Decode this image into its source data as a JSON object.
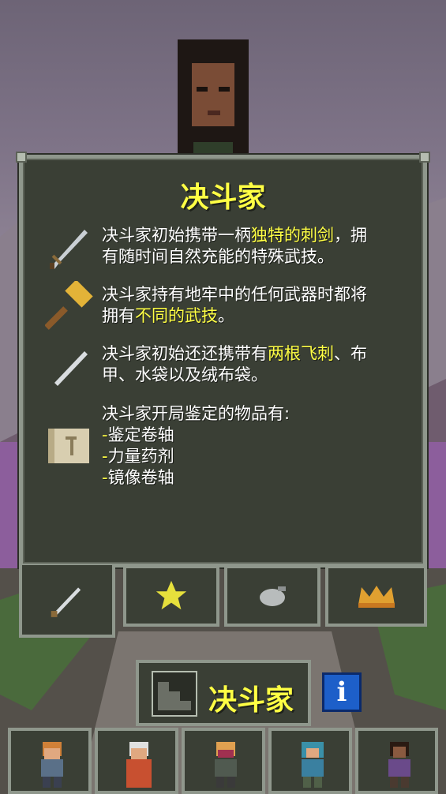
{
  "panel": {
    "title": "决斗家",
    "entries": [
      {
        "icon": "rapier-icon",
        "lines": [
          {
            "a": "决斗家初始携带一柄",
            "hl": "独特的刺剑",
            "b": "，拥"
          },
          {
            "a": "有随时间自然充能的特殊武技。",
            "hl": "",
            "b": ""
          }
        ]
      },
      {
        "icon": "hammer-icon",
        "lines": [
          {
            "a": "决斗家持有地牢中的任何武器时都将",
            "hl": "",
            "b": ""
          },
          {
            "a": "拥有",
            "hl": "不同的武技",
            "b": "。"
          }
        ]
      },
      {
        "icon": "throwing-spike-icon",
        "lines": [
          {
            "a": "决斗家初始还还携带有",
            "hl": "两根飞刺",
            "b": "、布"
          },
          {
            "a": "甲、水袋以及绒布袋。",
            "hl": "",
            "b": ""
          }
        ]
      },
      {
        "icon": "scroll-icon",
        "lines": [
          {
            "a": "决斗家开局鉴定的物品有:",
            "hl": "",
            "b": ""
          },
          {
            "a": "",
            "hl": "-",
            "b": "鉴定卷轴"
          },
          {
            "a": "",
            "hl": "-",
            "b": "力量药剂"
          },
          {
            "a": "",
            "hl": "-",
            "b": "镜像卷轴"
          }
        ]
      }
    ]
  },
  "tabs": [
    {
      "icon": "sword-icon",
      "active": true
    },
    {
      "icon": "star-icon",
      "active": false
    },
    {
      "icon": "pouch-icon",
      "active": false
    },
    {
      "icon": "crown-icon",
      "active": false
    }
  ],
  "class_button": {
    "label": "决斗家",
    "icon": "stairs-icon"
  },
  "info_button": {
    "label": "i"
  },
  "heroes": [
    "warrior",
    "mage",
    "rogue",
    "huntress",
    "duelist"
  ],
  "colors": {
    "highlight": "#ffff44",
    "panel_bg": "#3a3f35",
    "panel_border": "#8f978c"
  }
}
